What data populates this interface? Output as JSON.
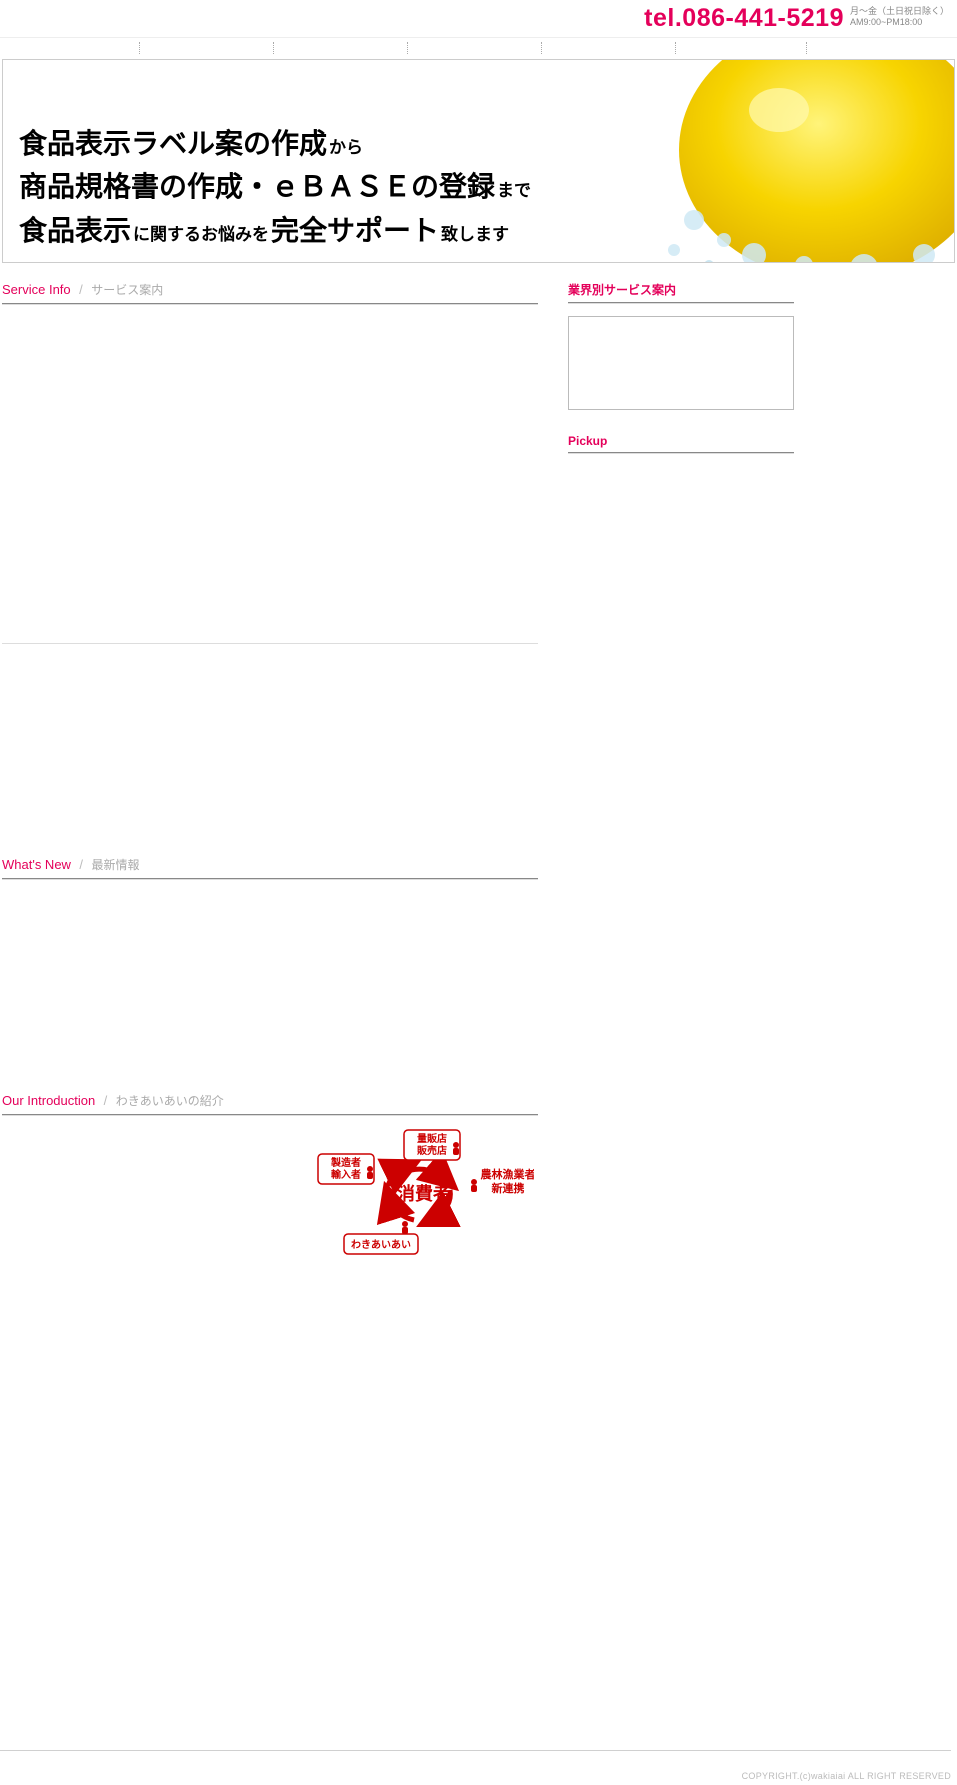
{
  "header": {
    "tel": "tel.086-441-5219",
    "hours_line1": "月～金（土日祝日除く）",
    "hours_line2": "AM9:00~PM18:00"
  },
  "hero": {
    "line1_a": "食品表示ラベル案の作成",
    "line1_b": "から",
    "line2_a": "商品規格書の作成・ｅＢＡＳＥの登録",
    "line2_b": "まで",
    "line3_a": "食品表示",
    "line3_b": "に関するお悩みを",
    "line3_c": "完全サポート",
    "line3_d": "致します"
  },
  "sections": {
    "service": {
      "en": "Service Info",
      "slash": "/",
      "jp": "サービス案内"
    },
    "news": {
      "en": "What's New",
      "slash": "/",
      "jp": "最新情報"
    },
    "intro": {
      "en": "Our Introduction",
      "slash": "/",
      "jp": "わきあいあいの紹介"
    }
  },
  "sidebar": {
    "industry_title": "業界別サービス案内",
    "pickup_title": "Pickup"
  },
  "diagram": {
    "center": "消費者",
    "nodes": {
      "top": {
        "l1": "量販店",
        "l2": "販売店"
      },
      "left": {
        "l1": "製造者",
        "l2": "輸入者"
      },
      "right": {
        "l1": "農林漁業者",
        "l2": "新連携"
      },
      "bottom": "わきあいあい"
    }
  },
  "footer": {
    "copy": "COPYRIGHT.(c)wakiaiai ALL RIGHT RESERVED"
  }
}
